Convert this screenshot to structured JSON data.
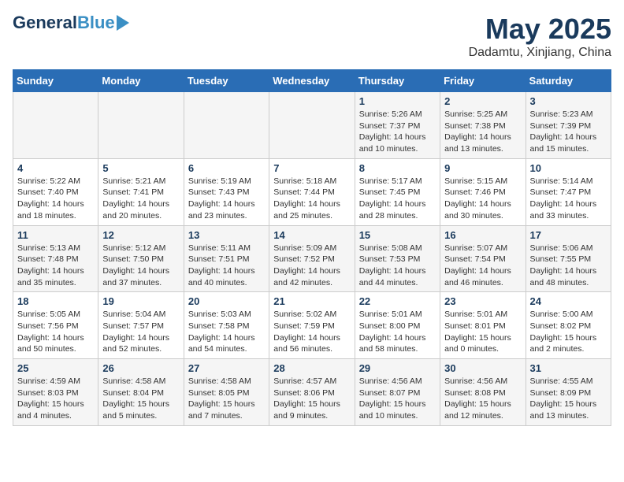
{
  "header": {
    "logo_general": "General",
    "logo_blue": "Blue",
    "title": "May 2025",
    "subtitle": "Dadamtu, Xinjiang, China"
  },
  "weekdays": [
    "Sunday",
    "Monday",
    "Tuesday",
    "Wednesday",
    "Thursday",
    "Friday",
    "Saturday"
  ],
  "weeks": [
    [
      {
        "day": "",
        "info": ""
      },
      {
        "day": "",
        "info": ""
      },
      {
        "day": "",
        "info": ""
      },
      {
        "day": "",
        "info": ""
      },
      {
        "day": "1",
        "info": "Sunrise: 5:26 AM\nSunset: 7:37 PM\nDaylight: 14 hours\nand 10 minutes."
      },
      {
        "day": "2",
        "info": "Sunrise: 5:25 AM\nSunset: 7:38 PM\nDaylight: 14 hours\nand 13 minutes."
      },
      {
        "day": "3",
        "info": "Sunrise: 5:23 AM\nSunset: 7:39 PM\nDaylight: 14 hours\nand 15 minutes."
      }
    ],
    [
      {
        "day": "4",
        "info": "Sunrise: 5:22 AM\nSunset: 7:40 PM\nDaylight: 14 hours\nand 18 minutes."
      },
      {
        "day": "5",
        "info": "Sunrise: 5:21 AM\nSunset: 7:41 PM\nDaylight: 14 hours\nand 20 minutes."
      },
      {
        "day": "6",
        "info": "Sunrise: 5:19 AM\nSunset: 7:43 PM\nDaylight: 14 hours\nand 23 minutes."
      },
      {
        "day": "7",
        "info": "Sunrise: 5:18 AM\nSunset: 7:44 PM\nDaylight: 14 hours\nand 25 minutes."
      },
      {
        "day": "8",
        "info": "Sunrise: 5:17 AM\nSunset: 7:45 PM\nDaylight: 14 hours\nand 28 minutes."
      },
      {
        "day": "9",
        "info": "Sunrise: 5:15 AM\nSunset: 7:46 PM\nDaylight: 14 hours\nand 30 minutes."
      },
      {
        "day": "10",
        "info": "Sunrise: 5:14 AM\nSunset: 7:47 PM\nDaylight: 14 hours\nand 33 minutes."
      }
    ],
    [
      {
        "day": "11",
        "info": "Sunrise: 5:13 AM\nSunset: 7:48 PM\nDaylight: 14 hours\nand 35 minutes."
      },
      {
        "day": "12",
        "info": "Sunrise: 5:12 AM\nSunset: 7:50 PM\nDaylight: 14 hours\nand 37 minutes."
      },
      {
        "day": "13",
        "info": "Sunrise: 5:11 AM\nSunset: 7:51 PM\nDaylight: 14 hours\nand 40 minutes."
      },
      {
        "day": "14",
        "info": "Sunrise: 5:09 AM\nSunset: 7:52 PM\nDaylight: 14 hours\nand 42 minutes."
      },
      {
        "day": "15",
        "info": "Sunrise: 5:08 AM\nSunset: 7:53 PM\nDaylight: 14 hours\nand 44 minutes."
      },
      {
        "day": "16",
        "info": "Sunrise: 5:07 AM\nSunset: 7:54 PM\nDaylight: 14 hours\nand 46 minutes."
      },
      {
        "day": "17",
        "info": "Sunrise: 5:06 AM\nSunset: 7:55 PM\nDaylight: 14 hours\nand 48 minutes."
      }
    ],
    [
      {
        "day": "18",
        "info": "Sunrise: 5:05 AM\nSunset: 7:56 PM\nDaylight: 14 hours\nand 50 minutes."
      },
      {
        "day": "19",
        "info": "Sunrise: 5:04 AM\nSunset: 7:57 PM\nDaylight: 14 hours\nand 52 minutes."
      },
      {
        "day": "20",
        "info": "Sunrise: 5:03 AM\nSunset: 7:58 PM\nDaylight: 14 hours\nand 54 minutes."
      },
      {
        "day": "21",
        "info": "Sunrise: 5:02 AM\nSunset: 7:59 PM\nDaylight: 14 hours\nand 56 minutes."
      },
      {
        "day": "22",
        "info": "Sunrise: 5:01 AM\nSunset: 8:00 PM\nDaylight: 14 hours\nand 58 minutes."
      },
      {
        "day": "23",
        "info": "Sunrise: 5:01 AM\nSunset: 8:01 PM\nDaylight: 15 hours\nand 0 minutes."
      },
      {
        "day": "24",
        "info": "Sunrise: 5:00 AM\nSunset: 8:02 PM\nDaylight: 15 hours\nand 2 minutes."
      }
    ],
    [
      {
        "day": "25",
        "info": "Sunrise: 4:59 AM\nSunset: 8:03 PM\nDaylight: 15 hours\nand 4 minutes."
      },
      {
        "day": "26",
        "info": "Sunrise: 4:58 AM\nSunset: 8:04 PM\nDaylight: 15 hours\nand 5 minutes."
      },
      {
        "day": "27",
        "info": "Sunrise: 4:58 AM\nSunset: 8:05 PM\nDaylight: 15 hours\nand 7 minutes."
      },
      {
        "day": "28",
        "info": "Sunrise: 4:57 AM\nSunset: 8:06 PM\nDaylight: 15 hours\nand 9 minutes."
      },
      {
        "day": "29",
        "info": "Sunrise: 4:56 AM\nSunset: 8:07 PM\nDaylight: 15 hours\nand 10 minutes."
      },
      {
        "day": "30",
        "info": "Sunrise: 4:56 AM\nSunset: 8:08 PM\nDaylight: 15 hours\nand 12 minutes."
      },
      {
        "day": "31",
        "info": "Sunrise: 4:55 AM\nSunset: 8:09 PM\nDaylight: 15 hours\nand 13 minutes."
      }
    ]
  ]
}
